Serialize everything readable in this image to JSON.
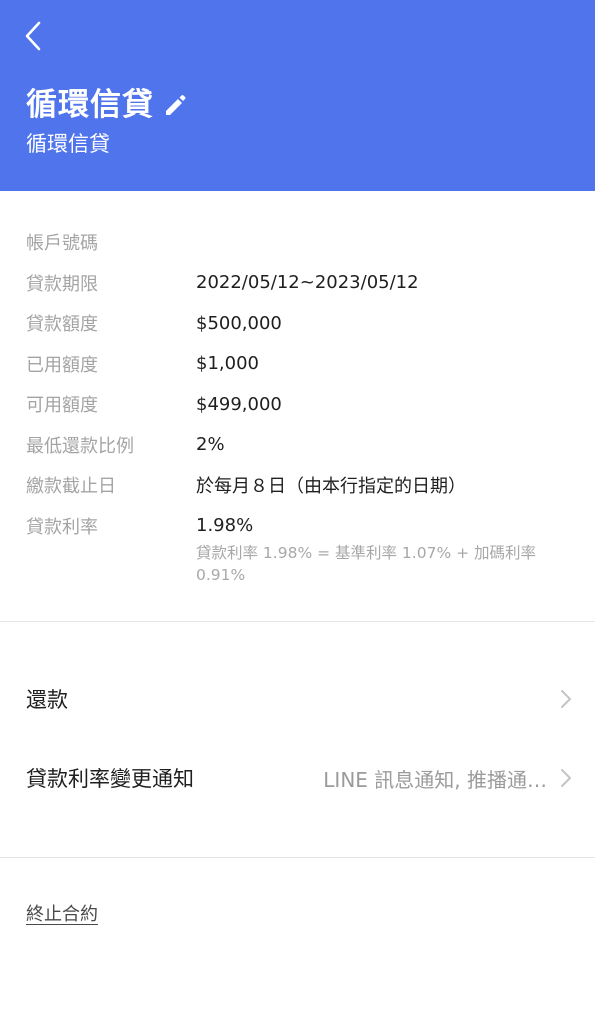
{
  "header": {
    "title": "循環信貸",
    "subtitle": "循環信貸",
    "back_icon": "chevron-left-icon",
    "edit_icon": "pencil-icon",
    "background": "#4f74ec"
  },
  "details": [
    {
      "label": "帳戶號碼",
      "value": ""
    },
    {
      "label": "貸款期限",
      "value": "2022/05/12~2023/05/12"
    },
    {
      "label": "貸款額度",
      "value": "$500,000"
    },
    {
      "label": "已用額度",
      "value": "$1,000"
    },
    {
      "label": "可用額度",
      "value": "$499,000"
    },
    {
      "label": "最低還款比例",
      "value": "2%"
    },
    {
      "label": "繳款截止日",
      "value": "於每月８日（由本行指定的日期）"
    },
    {
      "label": "貸款利率",
      "value": "1.98%"
    }
  ],
  "rate_note": "貸款利率 1.98% = 基準利率 1.07% + 加碼利率 0.91%",
  "menu": {
    "repay": {
      "label": "還款"
    },
    "rate_notice": {
      "label": "貸款利率變更通知",
      "value": "LINE 訊息通知, 推播通…"
    }
  },
  "terminate_link": "終止合約"
}
